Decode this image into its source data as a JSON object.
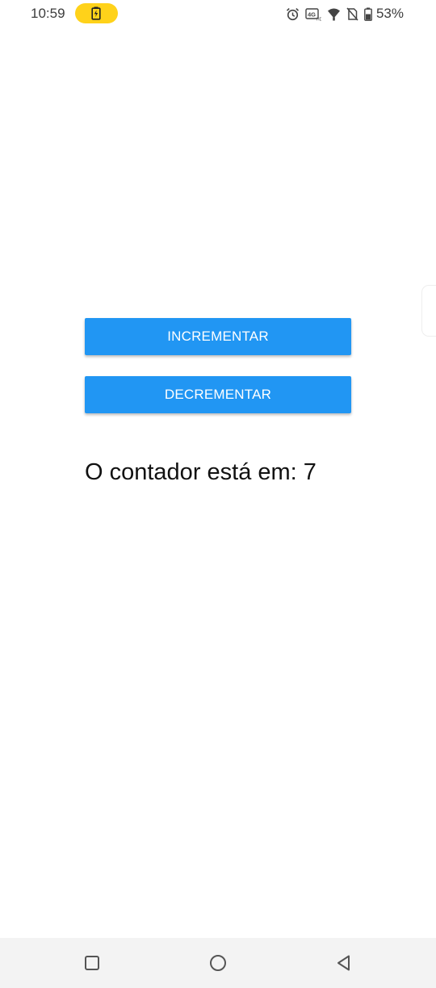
{
  "status_bar": {
    "time": "10:59",
    "battery_percent": "53%",
    "icons": [
      "battery-charging-icon",
      "alarm-icon",
      "hd-signal-icon",
      "wifi-icon",
      "no-sim-icon",
      "battery-icon"
    ]
  },
  "main": {
    "increment_label": "INCREMENTAR",
    "decrement_label": "DECREMENTAR",
    "counter_text": "O contador está em: 7"
  },
  "nav_bar": {
    "icons": [
      "recents-icon",
      "home-icon",
      "back-icon"
    ]
  },
  "colors": {
    "button_bg": "#2196f3",
    "button_text": "#ffffff",
    "charging_pill": "#ffd21a",
    "nav_bg": "#f3f3f3"
  }
}
